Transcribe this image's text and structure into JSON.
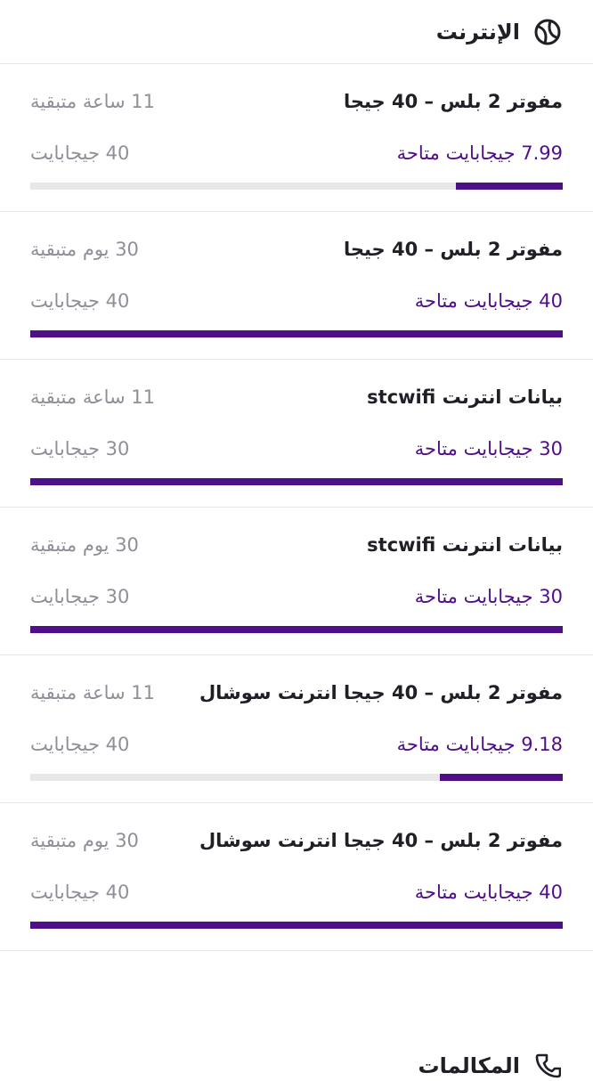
{
  "internet": {
    "title": "الإنترنت",
    "icon": "globe-icon",
    "items": [
      {
        "name": "مفوتر 2 بلس – 40 جيجا",
        "remaining": "11 ساعة متبقية",
        "available": "7.99 جيجابايت متاحة",
        "total": "40 جيجابايت",
        "used_fraction": 0.2
      },
      {
        "name": "مفوتر 2 بلس – 40 جيجا",
        "remaining": "30 يوم متبقية",
        "available": "40 جيجابايت متاحة",
        "total": "40 جيجابايت",
        "used_fraction": 1.0
      },
      {
        "name": "بيانات انترنت stcwifi",
        "remaining": "11 ساعة متبقية",
        "available": "30 جيجابايت متاحة",
        "total": "30 جيجابايت",
        "used_fraction": 1.0
      },
      {
        "name": "بيانات انترنت stcwifi",
        "remaining": "30 يوم متبقية",
        "available": "30 جيجابايت متاحة",
        "total": "30 جيجابايت",
        "used_fraction": 1.0
      },
      {
        "name": "مفوتر 2 بلس – 40 جيجا انترنت سوشال",
        "remaining": "11 ساعة متبقية",
        "available": "9.18 جيجابايت متاحة",
        "total": "40 جيجابايت",
        "used_fraction": 0.23
      },
      {
        "name": "مفوتر 2 بلس – 40 جيجا انترنت سوشال",
        "remaining": "30 يوم متبقية",
        "available": "40 جيجابايت متاحة",
        "total": "40 جيجابايت",
        "used_fraction": 1.0
      }
    ]
  },
  "calls": {
    "title": "المكالمات",
    "icon": "phone-icon"
  },
  "colors": {
    "accent": "#4f0f88",
    "muted": "#8f8f98",
    "track": "#e7e7ea"
  }
}
